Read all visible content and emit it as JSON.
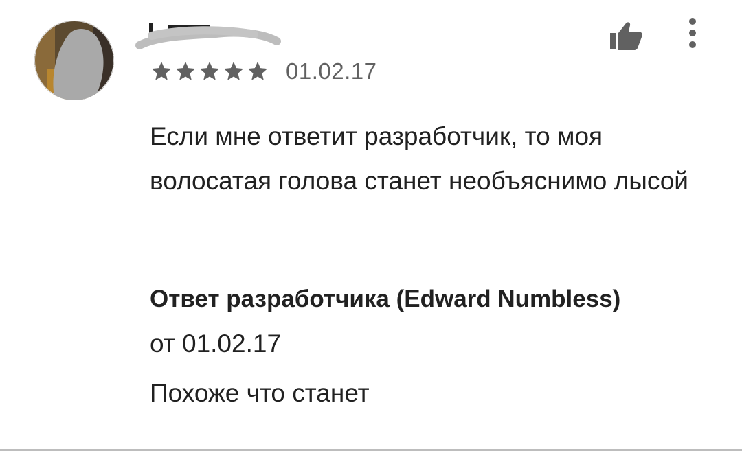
{
  "review": {
    "date": "01.02.17",
    "rating": 5,
    "rating_max": 5,
    "text": "Если мне ответит разработчик, то моя волосатая голова станет необъяснимо лысой",
    "star_color": "#616161",
    "icons": {
      "like": "thumbs-up-icon",
      "more": "more-vert-icon",
      "star": "star-icon"
    }
  },
  "developer_reply": {
    "title": "Ответ разработчика (Edward Numbless)",
    "date_line": "от 01.02.17",
    "text": "Похоже что станет"
  }
}
